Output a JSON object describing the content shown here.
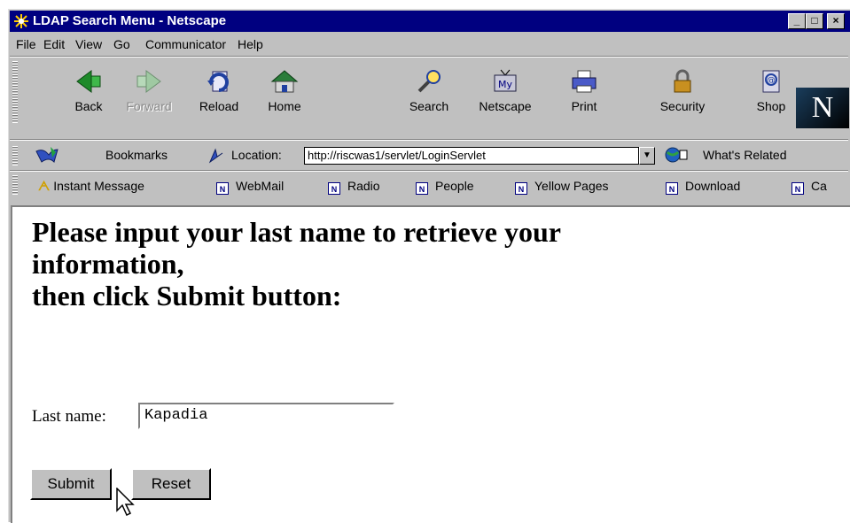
{
  "window": {
    "title": "LDAP Search Menu - Netscape",
    "controls": [
      "_",
      "□",
      "×"
    ]
  },
  "menu": [
    "File",
    "Edit",
    "View",
    "Go",
    "Communicator",
    "Help"
  ],
  "nav_toolbar": [
    {
      "label": "Back",
      "icon": "back-arrow-icon",
      "enabled": true
    },
    {
      "label": "Forward",
      "icon": "forward-arrow-icon",
      "enabled": false
    },
    {
      "label": "Reload",
      "icon": "reload-icon",
      "enabled": true
    },
    {
      "label": "Home",
      "icon": "home-icon",
      "enabled": true
    },
    {
      "label": "Search",
      "icon": "search-icon",
      "enabled": true
    },
    {
      "label": "Netscape",
      "icon": "my-netscape-icon",
      "enabled": true
    },
    {
      "label": "Print",
      "icon": "printer-icon",
      "enabled": true
    },
    {
      "label": "Security",
      "icon": "lock-icon",
      "enabled": true
    },
    {
      "label": "Shop",
      "icon": "shop-icon",
      "enabled": true
    }
  ],
  "logo": "N",
  "location_bar": {
    "bookmarks_label": "Bookmarks",
    "location_label": "Location:",
    "url": "http://riscwas1/servlet/LoginServlet",
    "whats_related": "What's Related"
  },
  "personal_toolbar": [
    "Instant Message",
    "WebMail",
    "Radio",
    "People",
    "Yellow Pages",
    "Download",
    "Ca"
  ],
  "page": {
    "heading_line1": "Please input your last name to retrieve your",
    "heading_line2": "information,",
    "heading_line3": "then click Submit button:",
    "last_name_label": "Last name:",
    "last_name_value": "Kapadia",
    "submit_label": "Submit",
    "reset_label": "Reset"
  },
  "colors": {
    "titlebar": "#000080",
    "chrome": "#c0c0c0",
    "page_bg": "#ffffff"
  }
}
